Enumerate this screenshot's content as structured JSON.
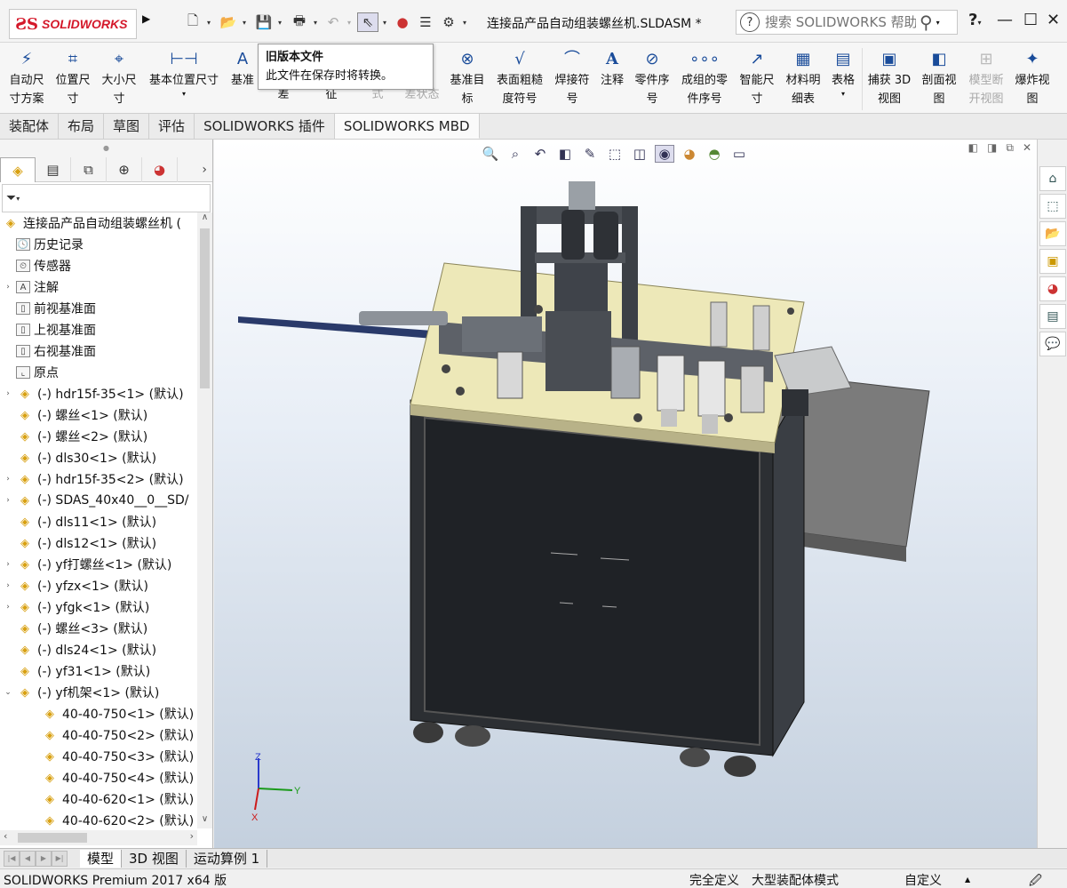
{
  "app": {
    "logo_text": "SOLIDWORKS",
    "doc_title": "连接品产品自动组装螺丝机.SLDASM *",
    "search_placeholder": "搜索 SOLIDWORKS 帮助",
    "help_mark": "?"
  },
  "ribbon": {
    "buttons": [
      {
        "label1": "自动尺",
        "label2": "寸方案",
        "icon": "auto-dimension-icon"
      },
      {
        "label1": "位置尺",
        "label2": "寸",
        "icon": "location-dimension-icon"
      },
      {
        "label1": "大小尺",
        "label2": "寸",
        "icon": "size-dimension-icon"
      },
      {
        "label1": "基本位置尺寸",
        "label2": "",
        "icon": "basic-location-dimension-icon"
      },
      {
        "label1": "基准",
        "label2": "",
        "icon": "datum-icon"
      },
      {
        "label1": "",
        "label2": "差",
        "icon": ""
      },
      {
        "label1": "",
        "label2": "征",
        "icon": ""
      },
      {
        "label1": "",
        "label2": "式",
        "icon": ""
      },
      {
        "label1": "",
        "label2": "差状态",
        "icon": ""
      },
      {
        "label1": "基准目",
        "label2": "标",
        "icon": "datum-target-icon"
      },
      {
        "label1": "表面粗糙",
        "label2": "度符号",
        "icon": "surface-finish-icon"
      },
      {
        "label1": "焊接符",
        "label2": "号",
        "icon": "weld-symbol-icon"
      },
      {
        "label1": "注释",
        "label2": "",
        "icon": "note-icon"
      },
      {
        "label1": "零件序",
        "label2": "号",
        "icon": "balloon-icon"
      },
      {
        "label1": "成组的零",
        "label2": "件序号",
        "icon": "stacked-balloon-icon"
      },
      {
        "label1": "智能尺",
        "label2": "寸",
        "icon": "smart-dimension-icon"
      },
      {
        "label1": "材料明",
        "label2": "细表",
        "icon": "bom-icon"
      },
      {
        "label1": "表格",
        "label2": "",
        "icon": "table-icon"
      },
      {
        "label1": "捕获 3D",
        "label2": "视图",
        "icon": "capture-3d-view-icon"
      },
      {
        "label1": "剖面视",
        "label2": "图",
        "icon": "section-view-icon"
      },
      {
        "label1": "模型断",
        "label2": "开视图",
        "icon": "model-break-view-icon"
      },
      {
        "label1": "爆炸视",
        "label2": "图",
        "icon": "explode-view-icon"
      }
    ]
  },
  "tooltip": {
    "title": "旧版本文件",
    "body": "此文件在保存时将转换。"
  },
  "tabs": [
    "装配体",
    "布局",
    "草图",
    "评估",
    "SOLIDWORKS 插件",
    "SOLIDWORKS MBD"
  ],
  "active_tab": "SOLIDWORKS MBD",
  "tree": {
    "root": "连接品产品自动组装螺丝机 (",
    "items": [
      {
        "label": "历史记录",
        "icon": "history-icon",
        "expand": ""
      },
      {
        "label": "传感器",
        "icon": "sensor-icon",
        "expand": ""
      },
      {
        "label": "注解",
        "icon": "annotation-icon",
        "expand": "›"
      },
      {
        "label": "前视基准面",
        "icon": "plane-icon",
        "expand": ""
      },
      {
        "label": "上视基准面",
        "icon": "plane-icon",
        "expand": ""
      },
      {
        "label": "右视基准面",
        "icon": "plane-icon",
        "expand": ""
      },
      {
        "label": "原点",
        "icon": "origin-icon",
        "expand": ""
      },
      {
        "label": "(-) hdr15f-35<1> (默认)",
        "icon": "assembly-icon",
        "expand": "›"
      },
      {
        "label": "(-) 螺丝<1> (默认)",
        "icon": "part-icon",
        "expand": ""
      },
      {
        "label": "(-) 螺丝<2> (默认)",
        "icon": "part-icon",
        "expand": ""
      },
      {
        "label": "(-) dls30<1> (默认)",
        "icon": "part-icon",
        "expand": ""
      },
      {
        "label": "(-) hdr15f-35<2> (默认)",
        "icon": "assembly-icon",
        "expand": "›"
      },
      {
        "label": "(-) SDAS_40x40__0__SD/",
        "icon": "assembly-icon",
        "expand": "›"
      },
      {
        "label": "(-) dls11<1> (默认)",
        "icon": "part-icon",
        "expand": ""
      },
      {
        "label": "(-) dls12<1> (默认)",
        "icon": "part-icon",
        "expand": ""
      },
      {
        "label": "(-) yf打螺丝<1> (默认)",
        "icon": "assembly-icon",
        "expand": "›"
      },
      {
        "label": "(-) yfzx<1> (默认)",
        "icon": "assembly-icon",
        "expand": "›"
      },
      {
        "label": "(-) yfgk<1> (默认)",
        "icon": "assembly-icon",
        "expand": "›"
      },
      {
        "label": "(-) 螺丝<3> (默认)",
        "icon": "part-icon",
        "expand": ""
      },
      {
        "label": "(-) dls24<1> (默认)",
        "icon": "part-icon",
        "expand": ""
      },
      {
        "label": "(-) yf31<1> (默认)",
        "icon": "part-icon",
        "expand": ""
      },
      {
        "label": "(-) yf机架<1> (默认)",
        "icon": "assembly-icon",
        "expand": "⌄"
      },
      {
        "label": "40-40-750<1> (默认)",
        "icon": "part-icon",
        "expand": "",
        "indent": true
      },
      {
        "label": "40-40-750<2> (默认)",
        "icon": "part-icon",
        "expand": "",
        "indent": true
      },
      {
        "label": "40-40-750<3> (默认)",
        "icon": "part-icon",
        "expand": "",
        "indent": true
      },
      {
        "label": "40-40-750<4> (默认)",
        "icon": "part-icon",
        "expand": "",
        "indent": true
      },
      {
        "label": "40-40-620<1> (默认)",
        "icon": "part-icon",
        "expand": "",
        "indent": true
      },
      {
        "label": "40-40-620<2> (默认)",
        "icon": "part-icon",
        "expand": "",
        "indent": true
      }
    ]
  },
  "bottom_tabs": [
    "模型",
    "3D 视图",
    "运动算例 1"
  ],
  "active_bottom_tab": "模型",
  "status": {
    "product": "SOLIDWORKS Premium 2017 x64 版",
    "definition": "完全定义",
    "mode": "大型装配体模式",
    "custom": "自定义"
  },
  "triad": {
    "x": "X",
    "y": "Y",
    "z": "Z"
  },
  "colors": {
    "brand": "#d4182a",
    "accent": "#1a4c9a",
    "table_top": "#ede8b8",
    "frame": "#2c2f33"
  }
}
